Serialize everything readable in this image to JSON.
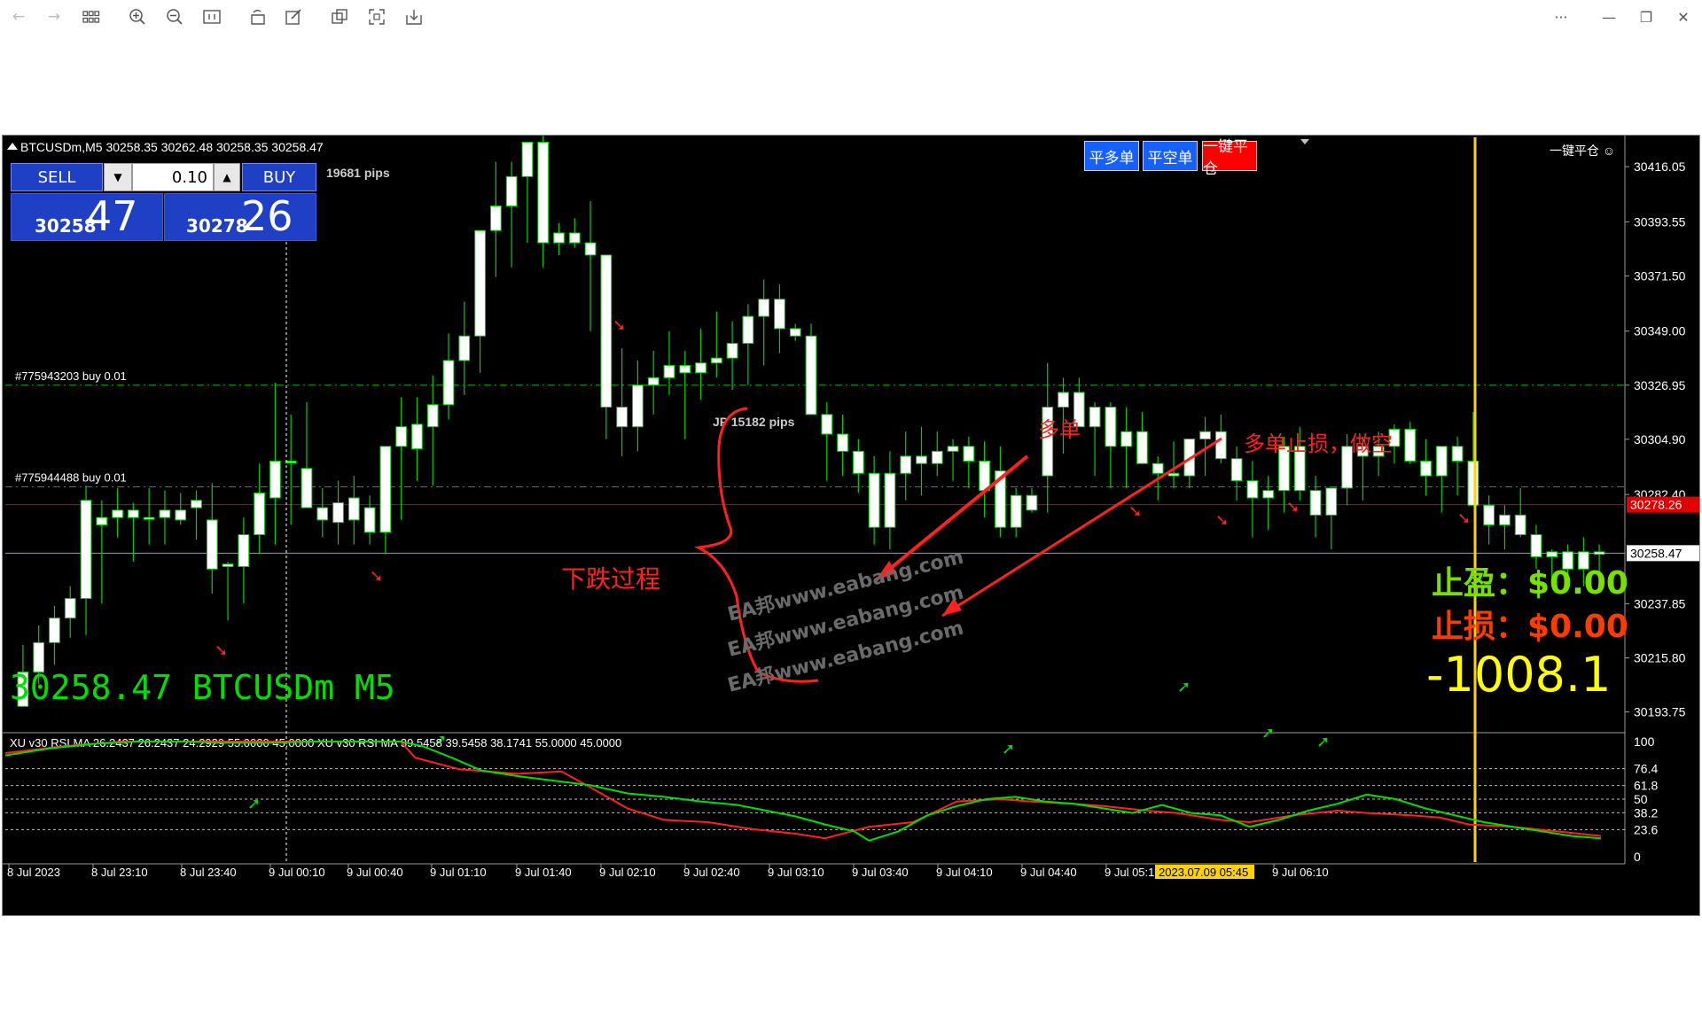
{
  "toolbar": {
    "icons": [
      "back-arrow-icon",
      "forward-arrow-icon",
      "grid-icon",
      "zoom-in-icon",
      "zoom-out-icon",
      "fit-icon",
      "rotate-icon",
      "edit-icon",
      "copy-icon",
      "fullscreen-icon",
      "save-icon"
    ],
    "window_controls": [
      "more-icon",
      "minimize-icon",
      "restore-icon",
      "close-icon"
    ],
    "more": "···",
    "minimize": "—",
    "restore": "❐",
    "close": "✕"
  },
  "chart": {
    "header": "BTCUSDm,M5  30258.35 30262.48 30258.35 30258.47",
    "bid_pips": "19681 pips",
    "jp_label": "JP  15182 pips",
    "trade_panel": {
      "sell_label": "SELL",
      "buy_label": "BUY",
      "lot": "0.10",
      "down_arrow": "▼",
      "up_arrow": "▲",
      "sell_small": "30258",
      "sell_big": "47",
      "buy_small": "30278",
      "buy_big": "26"
    },
    "close_buttons": {
      "close_long": "平多单",
      "close_short": "平空单",
      "close_all": "一键平仓"
    },
    "one_click_label": "一键平仓 ☺",
    "order_lines": [
      {
        "label": "#775943203 buy 0.01",
        "price": 30326.95
      },
      {
        "label": "#775944488 buy 0.01",
        "price": 30285.5
      }
    ],
    "bid_line_price": 30258.47,
    "ask_line_price": 30278.26,
    "bid_price_label": "30258.47",
    "ask_price_label": "30278.26",
    "big_symbol": "30258.47  BTCUSDm M5",
    "take_profit": "止盈：$0.00",
    "stop_loss": "止损：$0.00",
    "pnl": "-1008.1",
    "annotations": {
      "down_process": "下跌过程",
      "long_order": "多单",
      "stop_short": "多单止损，做空"
    },
    "watermark": "EA邦www.eabang.com",
    "rsi_header": "XU v30 RSI MA 26.2437 26.2437 24.2929 55.0000 45.0000  XU v30 RSI MA 39.5458 39.5458 38.1741 55.0000 45.0000",
    "time_cursor_label": "2023.07.09 05:45",
    "colors": {
      "bull_candle": "#ffffff",
      "bear_candle": "#ffffff",
      "wick": "#00d200",
      "ask_line": "#d00000",
      "bid_line": "#9aa0a8",
      "order_line": "#00b000",
      "cursor": "#ffd200",
      "rsi_up": "#00e000",
      "rsi_down": "#ff2020",
      "tp_text": "#78e000",
      "sl_text": "#ff3c00",
      "pnl_text": "#ffff00",
      "big_symbol": "#00e000",
      "red_arrow": "#ff2020",
      "green_arrow": "#00e000"
    }
  },
  "chart_data": {
    "type": "candlestick",
    "price_axis_ticks": [
      30416.05,
      30393.55,
      30371.5,
      30349.0,
      30326.95,
      30304.9,
      30282.4,
      30237.85,
      30215.8,
      30193.75
    ],
    "ylim": [
      30186,
      30428
    ],
    "time_labels": [
      "8 Jul 2023",
      "8 Jul 23:10",
      "8 Jul 23:40",
      "9 Jul 00:10",
      "9 Jul 00:40",
      "9 Jul 01:10",
      "9 Jul 01:40",
      "9 Jul 02:10",
      "9 Jul 02:40",
      "9 Jul 03:10",
      "9 Jul 03:40",
      "9 Jul 04:10",
      "9 Jul 04:40",
      "9 Jul 05:10",
      "9 Jul 06:10"
    ],
    "rsi_levels": [
      100,
      76.4,
      61.8,
      50,
      38.2,
      23.6,
      0
    ],
    "candles": [
      [
        30196,
        30221,
        30196,
        30210
      ],
      [
        30210,
        30229,
        30205,
        30222
      ],
      [
        30222,
        30237,
        30213,
        30232
      ],
      [
        30232,
        30245,
        30224,
        30240
      ],
      [
        30240,
        30286,
        30225,
        30280
      ],
      [
        30270,
        30280,
        30238,
        30273
      ],
      [
        30273,
        30285,
        30265,
        30276
      ],
      [
        30276,
        30279,
        30255,
        30273
      ],
      [
        30273,
        30285,
        30262,
        30273
      ],
      [
        30273,
        30284,
        30262,
        30276
      ],
      [
        30276,
        30283,
        30270,
        30272
      ],
      [
        30277,
        30284,
        30264,
        30280
      ],
      [
        30272,
        30287,
        30242,
        30252
      ],
      [
        30253,
        30255,
        30231,
        30254
      ],
      [
        30253,
        30273,
        30238,
        30266
      ],
      [
        30266,
        30295,
        30258,
        30283
      ],
      [
        30281,
        30328,
        30262,
        30296
      ],
      [
        30296,
        30315,
        30270,
        30296
      ],
      [
        30293,
        30320,
        30277,
        30277
      ],
      [
        30277,
        30285,
        30265,
        30272
      ],
      [
        30279,
        30288,
        30262,
        30271
      ],
      [
        30272,
        30290,
        30262,
        30281
      ],
      [
        30277,
        30282,
        30262,
        30267
      ],
      [
        30267,
        30287,
        30258,
        30302
      ],
      [
        30302,
        30322,
        30272,
        30310
      ],
      [
        30301,
        30322,
        30288,
        30311
      ],
      [
        30310,
        30331,
        30286,
        30319
      ],
      [
        30319,
        30348,
        30313,
        30337
      ],
      [
        30337,
        30361,
        30323,
        30347
      ],
      [
        30347,
        30371,
        30332,
        30390
      ],
      [
        30390,
        30418,
        30371,
        30400
      ],
      [
        30400,
        30418,
        30375,
        30412
      ],
      [
        30412,
        30425,
        30385,
        30426
      ],
      [
        30426,
        30430,
        30375,
        30385
      ],
      [
        30385,
        30393,
        30380,
        30389
      ],
      [
        30389,
        30395,
        30383,
        30385
      ],
      [
        30385,
        30402,
        30349,
        30380
      ],
      [
        30380,
        30379,
        30305,
        30318
      ],
      [
        30318,
        30342,
        30298,
        30310
      ],
      [
        30310,
        30337,
        30300,
        30327
      ],
      [
        30327,
        30341,
        30315,
        30330
      ],
      [
        30330,
        30349,
        30323,
        30335
      ],
      [
        30335,
        30341,
        30305,
        30332
      ],
      [
        30332,
        30350,
        30321,
        30336
      ],
      [
        30336,
        30357,
        30330,
        30338
      ],
      [
        30338,
        30353,
        30325,
        30344
      ],
      [
        30344,
        30360,
        30327,
        30355
      ],
      [
        30355,
        30370,
        30335,
        30362
      ],
      [
        30362,
        30368,
        30340,
        30350
      ],
      [
        30350,
        30352,
        30345,
        30347
      ],
      [
        30347,
        30352,
        30320,
        30315
      ],
      [
        30315,
        30320,
        30288,
        30307
      ],
      [
        30307,
        30315,
        30290,
        30300
      ],
      [
        30300,
        30305,
        30283,
        30291
      ],
      [
        30291,
        30298,
        30262,
        30269
      ],
      [
        30269,
        30300,
        30260,
        30291
      ],
      [
        30291,
        30308,
        30280,
        30298
      ],
      [
        30298,
        30310,
        30282,
        30295
      ],
      [
        30295,
        30308,
        30290,
        30300
      ],
      [
        30300,
        30305,
        30288,
        30302
      ],
      [
        30302,
        30306,
        30285,
        30296
      ],
      [
        30296,
        30304,
        30273,
        30284
      ],
      [
        30292,
        30302,
        30265,
        30269
      ],
      [
        30269,
        30285,
        30265,
        30282
      ],
      [
        30282,
        30285,
        30275,
        30276
      ],
      [
        30290,
        30336,
        30275,
        30318
      ],
      [
        30318,
        30330,
        30299,
        30324
      ],
      [
        30324,
        30330,
        30317,
        30310
      ],
      [
        30310,
        30320,
        30290,
        30318
      ],
      [
        30318,
        30320,
        30285,
        30302
      ],
      [
        30302,
        30318,
        30285,
        30308
      ],
      [
        30308,
        30316,
        30295,
        30295
      ],
      [
        30295,
        30298,
        30280,
        30291
      ],
      [
        30291,
        30304,
        30285,
        30290
      ],
      [
        30290,
        30302,
        30285,
        30305
      ],
      [
        30305,
        30314,
        30290,
        30308
      ],
      [
        30308,
        30315,
        30295,
        30297
      ],
      [
        30297,
        30302,
        30280,
        30288
      ],
      [
        30288,
        30296,
        30265,
        30281
      ],
      [
        30281,
        30290,
        30268,
        30284
      ],
      [
        30284,
        30306,
        30275,
        30302
      ],
      [
        30302,
        30310,
        30280,
        30284
      ],
      [
        30284,
        30290,
        30265,
        30274
      ],
      [
        30274,
        30280,
        30260,
        30285
      ],
      [
        30285,
        30307,
        30278,
        30302
      ],
      [
        30302,
        30306,
        30280,
        30298
      ],
      [
        30298,
        30308,
        30290,
        30302
      ],
      [
        30302,
        30311,
        30295,
        30309
      ],
      [
        30309,
        30312,
        30295,
        30296
      ],
      [
        30296,
        30305,
        30282,
        30290
      ],
      [
        30290,
        30300,
        30275,
        30302
      ],
      [
        30302,
        30306,
        30282,
        30296
      ],
      [
        30296,
        30316,
        30285,
        30278
      ],
      [
        30278,
        30282,
        30262,
        30270
      ],
      [
        30270,
        30278,
        30260,
        30274
      ],
      [
        30274,
        30285,
        30265,
        30266
      ],
      [
        30266,
        30270,
        30252,
        30257
      ],
      [
        30257,
        30260,
        30248,
        30259
      ],
      [
        30259,
        30262,
        30250,
        30252
      ],
      [
        30252,
        30265,
        30245,
        30259
      ],
      [
        30259,
        30262,
        30250,
        30258
      ]
    ],
    "rsi_green": [
      [
        0,
        88
      ],
      [
        6,
        94
      ],
      [
        12,
        98
      ],
      [
        18,
        100
      ],
      [
        24,
        100
      ],
      [
        30,
        99
      ],
      [
        36,
        99
      ],
      [
        42,
        100
      ],
      [
        48,
        100
      ],
      [
        54,
        100
      ],
      [
        57,
        96
      ],
      [
        61,
        86
      ],
      [
        65,
        75
      ],
      [
        70,
        70
      ],
      [
        75,
        66
      ],
      [
        80,
        62
      ],
      [
        85,
        55
      ],
      [
        90,
        52
      ],
      [
        95,
        48
      ],
      [
        100,
        45
      ],
      [
        104,
        40
      ],
      [
        108,
        35
      ],
      [
        112,
        28
      ],
      [
        116,
        22
      ],
      [
        118,
        14
      ],
      [
        122,
        22
      ],
      [
        126,
        36
      ],
      [
        130,
        44
      ],
      [
        134,
        50
      ],
      [
        138,
        52
      ],
      [
        142,
        48
      ],
      [
        146,
        46
      ],
      [
        150,
        42
      ],
      [
        154,
        38
      ],
      [
        158,
        45
      ],
      [
        162,
        38
      ],
      [
        166,
        36
      ],
      [
        170,
        26
      ],
      [
        174,
        32
      ],
      [
        178,
        40
      ],
      [
        182,
        46
      ],
      [
        186,
        54
      ],
      [
        190,
        50
      ],
      [
        194,
        42
      ],
      [
        198,
        36
      ],
      [
        202,
        30
      ],
      [
        206,
        26
      ],
      [
        210,
        22
      ],
      [
        214,
        18
      ],
      [
        218,
        16
      ]
    ],
    "rsi_red": [
      [
        0,
        90
      ],
      [
        8,
        96
      ],
      [
        16,
        100
      ],
      [
        24,
        100
      ],
      [
        32,
        100
      ],
      [
        40,
        100
      ],
      [
        48,
        100
      ],
      [
        54,
        100
      ],
      [
        56,
        86
      ],
      [
        62,
        76
      ],
      [
        70,
        72
      ],
      [
        76,
        74
      ],
      [
        80,
        60
      ],
      [
        85,
        42
      ],
      [
        90,
        32
      ],
      [
        96,
        30
      ],
      [
        102,
        24
      ],
      [
        108,
        20
      ],
      [
        112,
        16
      ],
      [
        118,
        26
      ],
      [
        124,
        30
      ],
      [
        130,
        48
      ],
      [
        136,
        50
      ],
      [
        140,
        48
      ],
      [
        146,
        46
      ],
      [
        150,
        44
      ],
      [
        156,
        40
      ],
      [
        160,
        38
      ],
      [
        166,
        32
      ],
      [
        170,
        30
      ],
      [
        176,
        36
      ],
      [
        182,
        40
      ],
      [
        186,
        38
      ],
      [
        192,
        36
      ],
      [
        196,
        34
      ],
      [
        200,
        28
      ],
      [
        206,
        26
      ],
      [
        212,
        22
      ],
      [
        218,
        18
      ]
    ]
  }
}
